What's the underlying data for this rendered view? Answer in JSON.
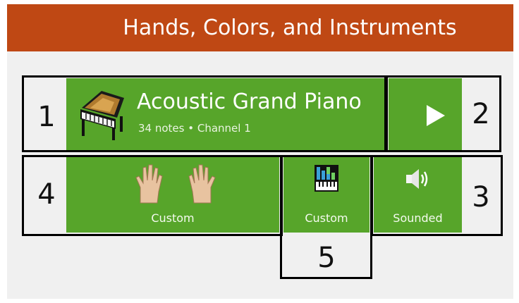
{
  "header": {
    "title": "Hands, Colors, and Instruments"
  },
  "instrument": {
    "name": "Acoustic Grand Piano",
    "details": "34 notes • Channel 1",
    "icon": "grand-piano-icon"
  },
  "play": {
    "icon": "play-icon"
  },
  "hands": {
    "label": "Custom",
    "icon": "hands-icon"
  },
  "colors": {
    "label": "Custom",
    "icon": "color-keyboard-icon"
  },
  "sound": {
    "label": "Sounded",
    "icon": "speaker-icon"
  },
  "callouts": [
    "1",
    "2",
    "3",
    "4",
    "5"
  ],
  "theme": {
    "accent": "#bf4814",
    "panel": "#57a52a",
    "background": "#f0f0f0"
  }
}
